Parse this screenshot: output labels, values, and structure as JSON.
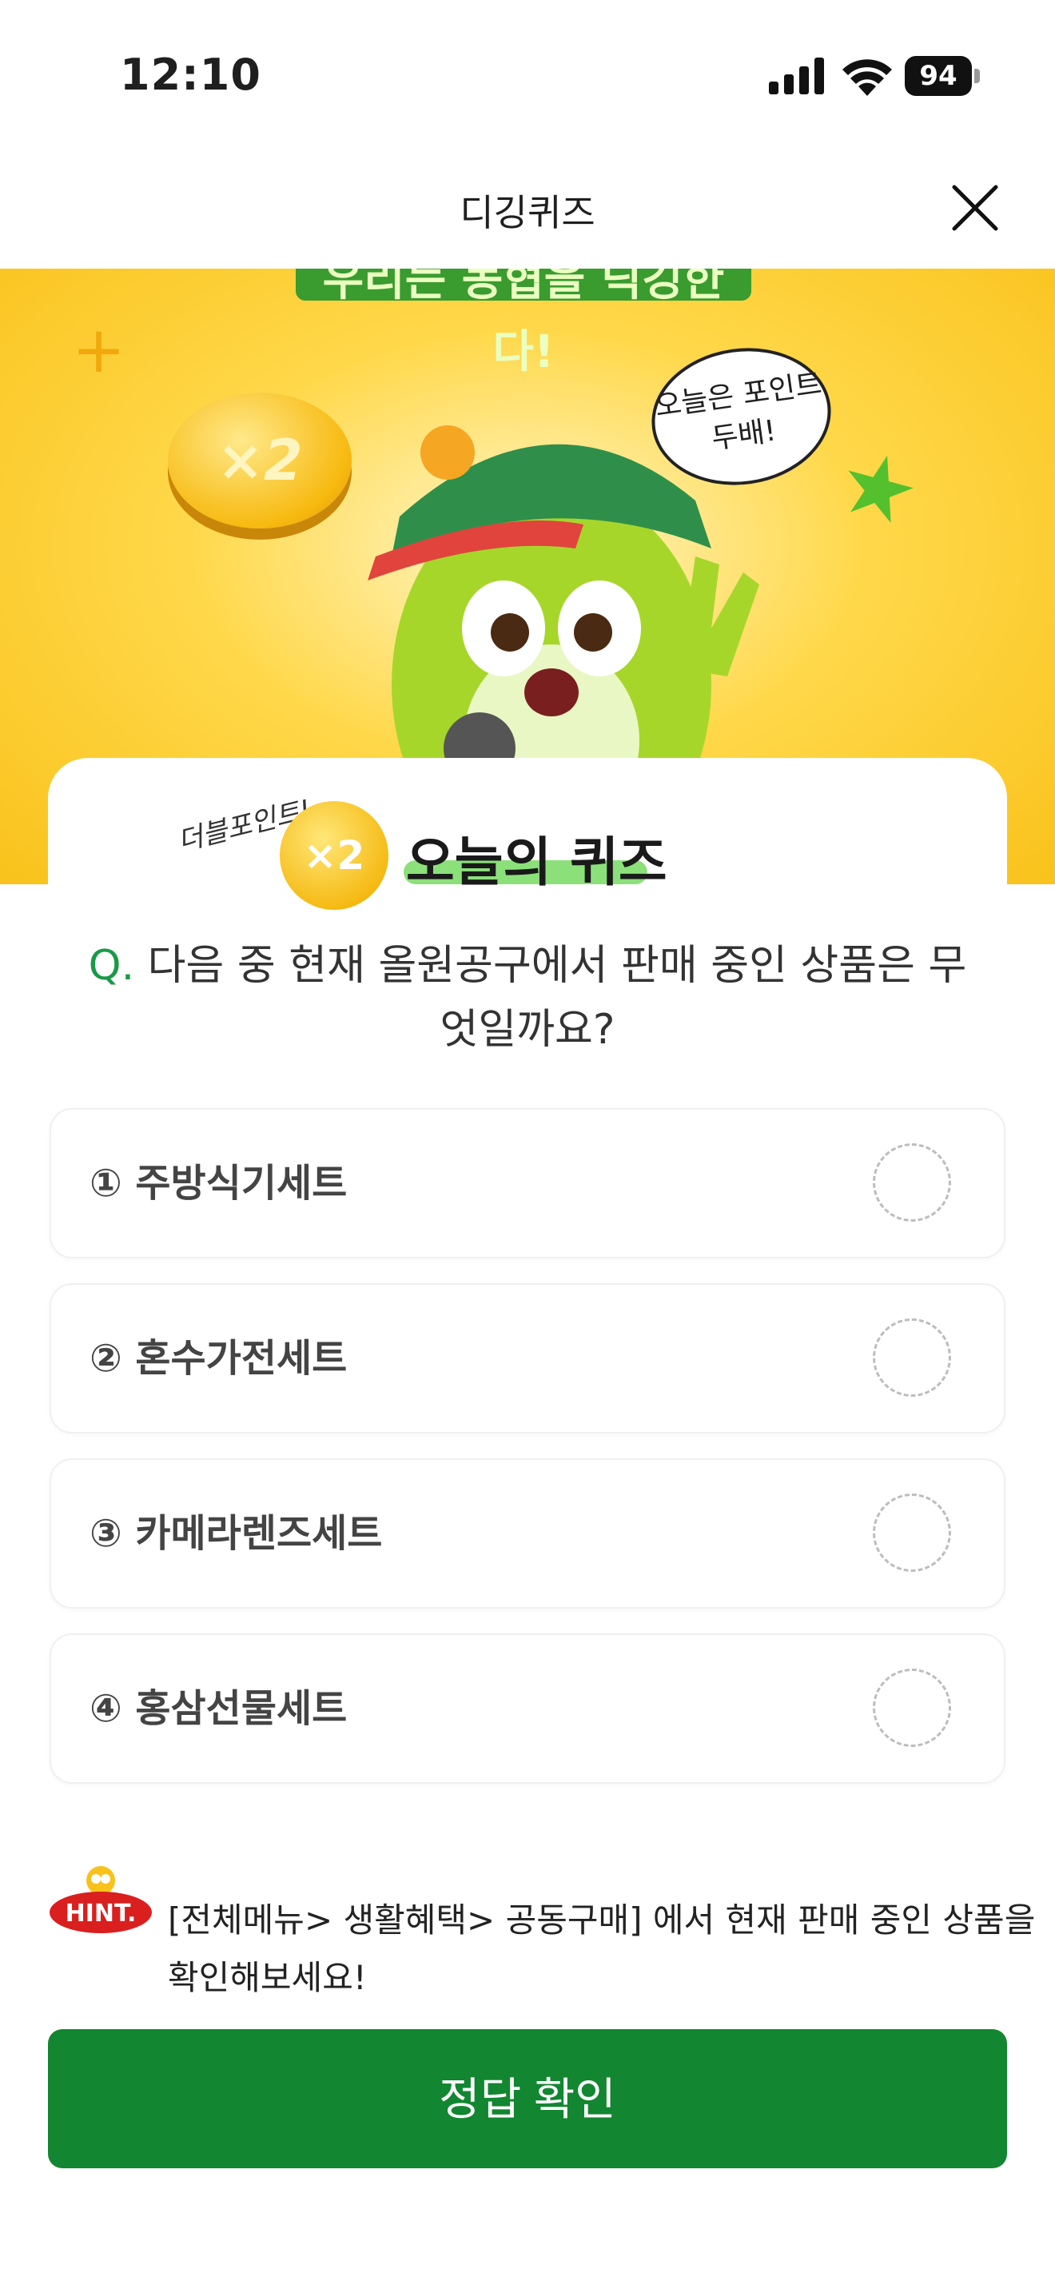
{
  "status_bar": {
    "time": "12:10",
    "battery": "94"
  },
  "header": {
    "title": "디깅퀴즈"
  },
  "banner": {
    "headline": "우리는 농협을 딕깅한다!",
    "coin_text": "×2",
    "speech": "오늘은 포인트 두배!"
  },
  "quiz_badge": {
    "script": "더블포인트!",
    "coin_text": "×2",
    "title": "오늘의 퀴즈"
  },
  "question": {
    "prefix": "Q.",
    "text": "다음 중 현재 올원공구에서 판매 중인 상품은 무엇일까요?"
  },
  "options": [
    {
      "label": "① 주방식기세트"
    },
    {
      "label": "② 혼수가전세트"
    },
    {
      "label": "③ 카메라렌즈세트"
    },
    {
      "label": "④ 홍삼선물세트"
    }
  ],
  "hint": {
    "tag": "HINT.",
    "text": "[전체메뉴> 생활혜택> 공동구매] 에서 현재 판매 중인 상품을 확인해보세요!"
  },
  "confirm_button": {
    "label": "정답 확인"
  },
  "colors": {
    "primary": "#128630",
    "question_prefix": "#1a9a47",
    "banner": "#ffd84a",
    "hint_tag": "#d9201f"
  }
}
